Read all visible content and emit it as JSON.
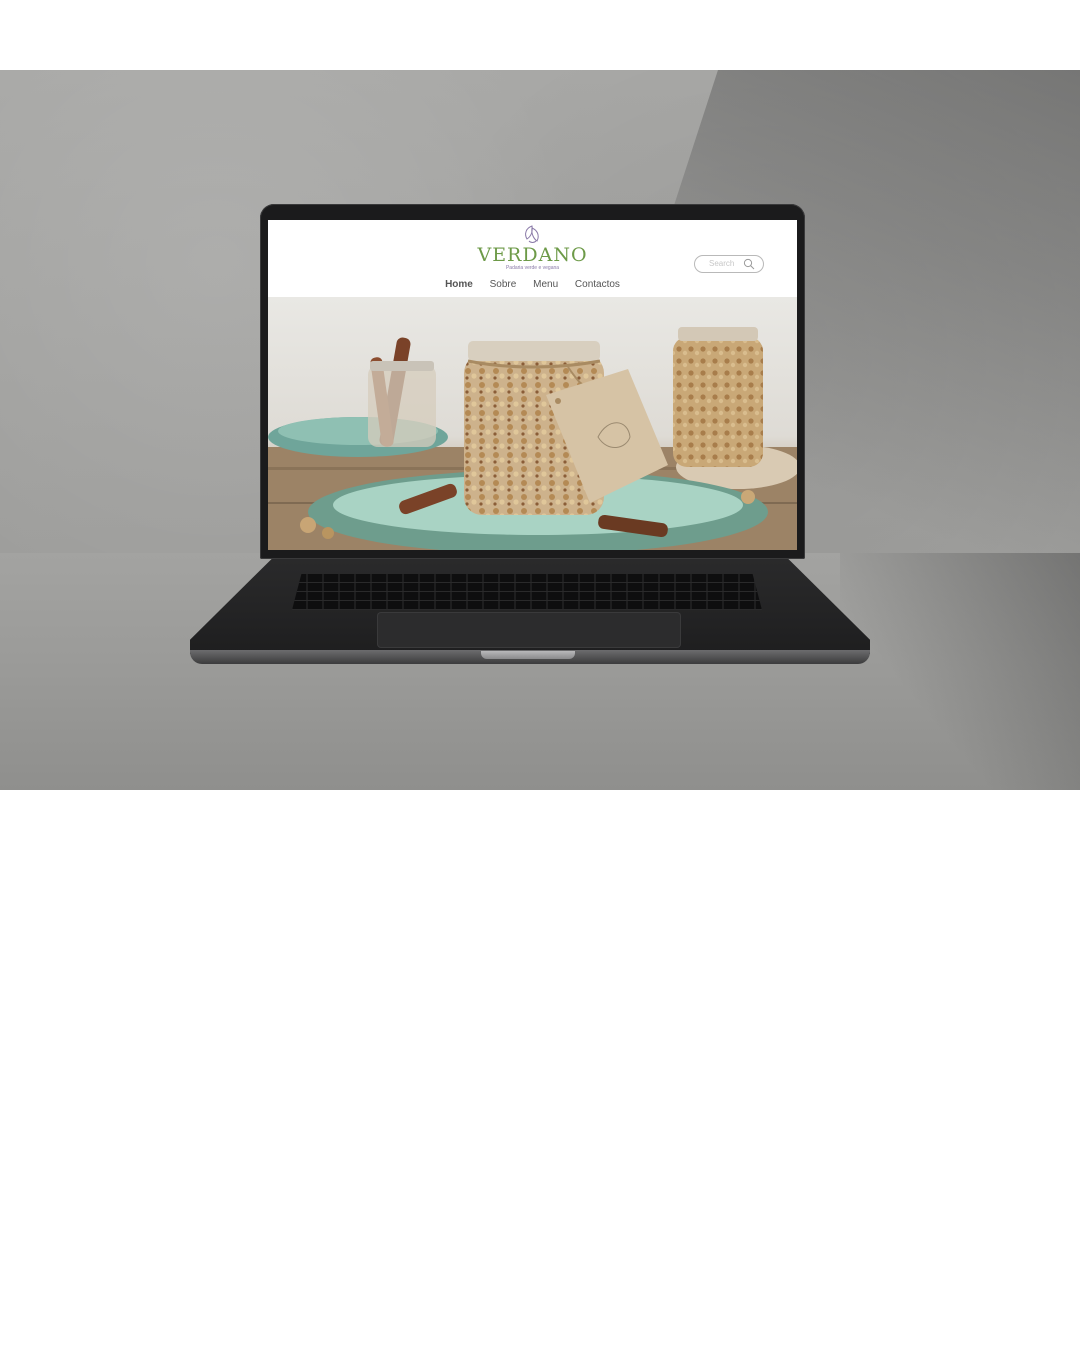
{
  "site": {
    "brand": "VERDANO",
    "tagline": "Padaria verde e vegana",
    "search": {
      "placeholder": "Search"
    },
    "nav": [
      {
        "label": "Home",
        "active": true
      },
      {
        "label": "Sobre",
        "active": false
      },
      {
        "label": "Menu",
        "active": false
      },
      {
        "label": "Contactos",
        "active": false
      }
    ],
    "hero": {
      "image": "granola-jars-photo"
    },
    "colors": {
      "brand_green": "#6d9a48",
      "tagline_purple": "#8a7aa8",
      "nav_text": "#555555"
    },
    "icons": [
      "logo-leaf-icon",
      "search-icon"
    ]
  },
  "scene": {
    "device": "laptop",
    "photo": "laptop-on-concrete-mockup"
  }
}
